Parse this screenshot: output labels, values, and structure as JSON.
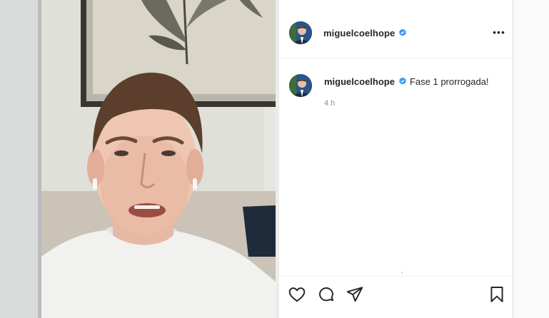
{
  "post": {
    "username": "miguelcoelhope",
    "more_label": "•••",
    "verified_icon": "verified-badge-icon",
    "media_description_icon": "video-frame"
  },
  "comment": {
    "username": "miguelcoelhope",
    "text": "Fase 1 prorrogada!",
    "time": "4 h"
  },
  "actions": {
    "like_icon": "heart-icon",
    "comment_icon": "speech-bubble-icon",
    "share_icon": "paper-plane-icon",
    "save_icon": "bookmark-icon"
  },
  "colors": {
    "verified": "#3897f0",
    "text": "#262626",
    "muted": "#8e8e8e"
  }
}
